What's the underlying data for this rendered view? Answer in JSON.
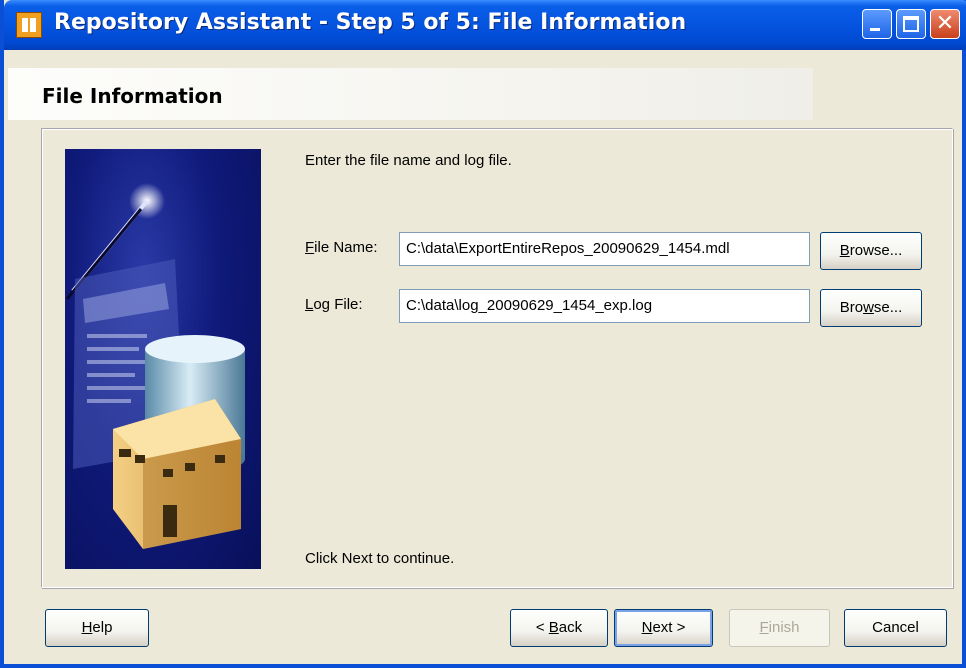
{
  "window": {
    "title": "Repository Assistant - Step 5 of 5: File Information",
    "app_icon": "wizard-app-icon",
    "controls": [
      "minimize-icon",
      "maximize-icon",
      "close-icon"
    ],
    "close_glyph": "✕"
  },
  "header": {
    "title": "File Information"
  },
  "content": {
    "instruction": "Enter the file name and log file.",
    "footer_note": "Click Next to continue."
  },
  "fields": {
    "file_name": {
      "label_prefix": "",
      "label_mnemonic": "F",
      "label_rest": "ile Name:",
      "value": "C:\\data\\ExportEntireRepos_20090629_1454.mdl",
      "browse_mnemonic": "B",
      "browse_rest": "rowse..."
    },
    "log_file": {
      "label_prefix": "",
      "label_mnemonic": "L",
      "label_rest": "og File:",
      "value": "C:\\data\\log_20090629_1454_exp.log",
      "browse_prefix": "Bro",
      "browse_mnemonic": "w",
      "browse_rest": "se..."
    }
  },
  "buttons": {
    "help": {
      "mnemonic": "H",
      "rest": "elp"
    },
    "back": {
      "prefix": "< ",
      "mnemonic": "B",
      "rest": "ack"
    },
    "next": {
      "mnemonic": "N",
      "rest": "ext >"
    },
    "finish": {
      "mnemonic": "F",
      "rest": "inish"
    },
    "cancel": {
      "label": "Cancel"
    }
  },
  "colors": {
    "title_bar": "#0554e0",
    "dialog_bg": "#ece9d8",
    "image_bg": "#0f1a7a"
  }
}
